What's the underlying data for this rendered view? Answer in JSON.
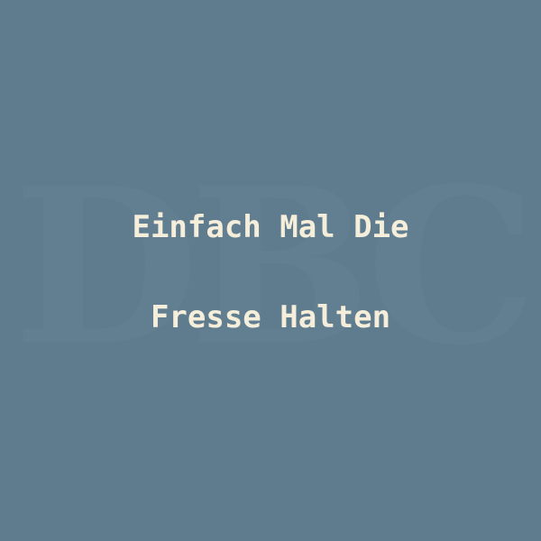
{
  "background_color": "#5f7b8e",
  "text_color": "#f5eedb",
  "watermark": {
    "text": "DBC",
    "color": "#7d97a8"
  },
  "quote": {
    "line1": "Einfach Mal Die",
    "line2": "Fresse Halten"
  }
}
